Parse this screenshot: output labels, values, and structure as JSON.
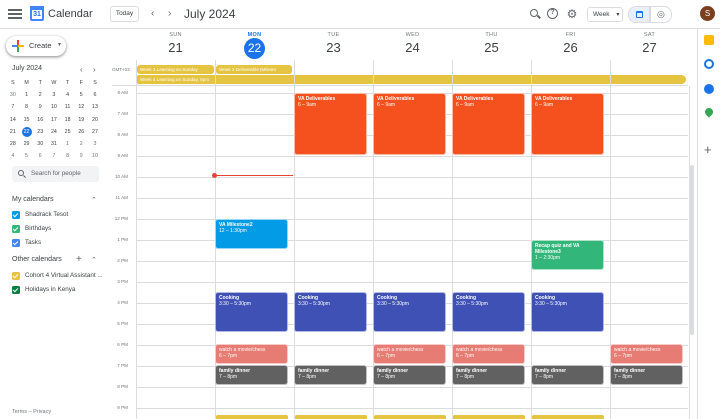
{
  "header": {
    "app_title": "Calendar",
    "logo_day": "31",
    "today_label": "Today",
    "prev": "‹",
    "next": "›",
    "month_title": "July 2024",
    "view_label": "Week",
    "view_caret": "▾",
    "help_glyph": "?",
    "settings_glyph": "⚙",
    "task_glyph": "◎",
    "avatar_letter": "S"
  },
  "sidebar": {
    "create_label": "Create",
    "create_caret": "▾",
    "mini_title": "July 2024",
    "mini_prev": "‹",
    "mini_next": "›",
    "weekday_letters": [
      "S",
      "M",
      "T",
      "W",
      "T",
      "F",
      "S"
    ],
    "mini_weeks": [
      [
        "30",
        "1",
        "2",
        "3",
        "4",
        "5",
        "6"
      ],
      [
        "7",
        "8",
        "9",
        "10",
        "11",
        "12",
        "13"
      ],
      [
        "14",
        "15",
        "16",
        "17",
        "18",
        "19",
        "20"
      ],
      [
        "21",
        "22",
        "23",
        "24",
        "25",
        "26",
        "27"
      ],
      [
        "28",
        "29",
        "30",
        "31",
        "1",
        "2",
        "3"
      ],
      [
        "4",
        "5",
        "6",
        "7",
        "8",
        "9",
        "10"
      ]
    ],
    "search_people_placeholder": "Search for people",
    "my_calendars_title": "My calendars",
    "my_calendars": [
      {
        "label": "Shadrack Tesot",
        "color": "#039be5"
      },
      {
        "label": "Birthdays",
        "color": "#33b679"
      },
      {
        "label": "Tasks",
        "color": "#4285f4"
      }
    ],
    "other_calendars_title": "Other calendars",
    "other_plus": "+",
    "section_caret": "⌃",
    "other_calendars": [
      {
        "label": "Cohort 4 Virtual Assistant ...",
        "color": "#e4c441"
      },
      {
        "label": "Holidays in Kenya",
        "color": "#0b8043"
      }
    ],
    "footer": "Terms – Privacy"
  },
  "grid": {
    "timezone": "GMT+03",
    "days": [
      {
        "dow": "SUN",
        "num": "21"
      },
      {
        "dow": "MON",
        "num": "22"
      },
      {
        "dow": "TUE",
        "num": "23"
      },
      {
        "dow": "WED",
        "num": "24"
      },
      {
        "dow": "THU",
        "num": "25"
      },
      {
        "dow": "FRI",
        "num": "26"
      },
      {
        "dow": "SAT",
        "num": "27"
      }
    ],
    "hours": [
      "6 AM",
      "7 AM",
      "8 AM",
      "9 AM",
      "10 AM",
      "11 AM",
      "12 PM",
      "1 PM",
      "2 PM",
      "3 PM",
      "4 PM",
      "5 PM",
      "6 PM",
      "7 PM",
      "8 PM",
      "9 PM"
    ],
    "allday": {
      "ev1": "Week 3 Learning on Sunday",
      "ev2": "Week 3 Deliverable (Milesto",
      "ev3": "Week 4 Learning on Sunday, 9pm"
    }
  },
  "events": {
    "deliv_title": "VA Deliverables",
    "deliv_time": "6 – 9am",
    "milestone_title": "VA Milestone2",
    "milestone_time": "12 – 1:30pm",
    "recap_title": "Recap quiz and VA Milestone3",
    "recap_time": "1 – 2:30pm",
    "cooking_title": "Cooking",
    "cooking_time": "3:30 – 5:30pm",
    "movie_title": "watch a movie/chess",
    "movie_time": "6 – 7pm",
    "dinner_title": "family dinner",
    "dinner_time": "7 – 8pm"
  },
  "colors": {
    "deliverables": "#f4511e",
    "milestone": "#039be5",
    "recap": "#33b679",
    "cooking": "#3f51b5",
    "movie": "#e67c73",
    "dinner": "#616161",
    "allday": "#e4c441"
  }
}
